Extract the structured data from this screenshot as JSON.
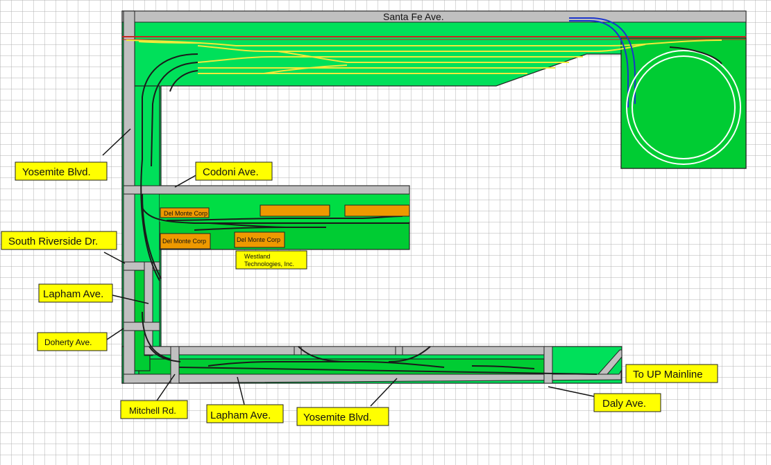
{
  "diagram": {
    "title_street": "Santa Fe Ave.",
    "colors": {
      "background": "#ffffff",
      "grid": "#b0b0b0",
      "board_light": "#00e05a",
      "board_dark": "#00cc33",
      "road": "#c0c0c0",
      "track": "#1a1a1a",
      "yard_track": "#f2ea3a",
      "main_line": "#cc2222",
      "up_main": "#1a33cc",
      "label_bg": "#ffff00",
      "industry": "#ee9900"
    },
    "labels": {
      "yosemite_left": "Yosemite Blvd.",
      "codoni": "Codoni Ave.",
      "south_riverside": "South Riverside Dr.",
      "lapham_left": "Lapham Ave.",
      "doherty": "Doherty Ave.",
      "mitchell": "Mitchell Rd.",
      "lapham_bottom": "Lapham Ave.",
      "yosemite_bottom": "Yosemite Blvd.",
      "daly": "Daly Ave.",
      "to_up": "To UP Mainline"
    },
    "industries": {
      "del_monte_1": "Del Monte Corp",
      "del_monte_2": "Del Monte Corp",
      "del_monte_3": "Del Monte Corp",
      "westland_line1": "Westland",
      "westland_line2": "Technologies, Inc."
    }
  }
}
